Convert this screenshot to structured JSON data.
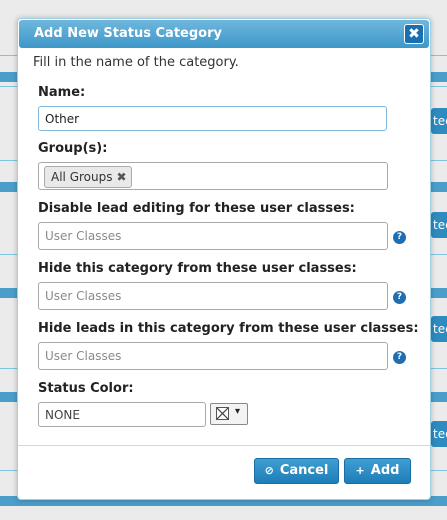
{
  "dialog": {
    "title": "Add New Status Category",
    "close_glyph": "✖",
    "intro": "Fill in the name of the category."
  },
  "form": {
    "name": {
      "label": "Name:",
      "value": "Other"
    },
    "groups": {
      "label": "Group(s):",
      "tags": [
        {
          "label": "All Groups",
          "remove_glyph": "✖"
        }
      ]
    },
    "disable_editing": {
      "label": "Disable lead editing for these user classes:",
      "placeholder": "User Classes"
    },
    "hide_category": {
      "label": "Hide this category from these user classes:",
      "placeholder": "User Classes"
    },
    "hide_leads": {
      "label": "Hide leads in this category from these user classes:",
      "placeholder": "User Classes"
    },
    "status_color": {
      "label": "Status Color:",
      "value": "NONE",
      "caret": "▾"
    },
    "help_glyph": "?"
  },
  "buttons": {
    "cancel": {
      "label": "Cancel",
      "icon": "⊘"
    },
    "add": {
      "label": "Add",
      "icon": "+"
    }
  },
  "background": {
    "tab_fragment": "tec"
  },
  "colors": {
    "accent": "#2e8bc0",
    "title_bar": "#4a9fcf",
    "button": "#2a8cc5",
    "help_icon": "#1f6fb0"
  }
}
